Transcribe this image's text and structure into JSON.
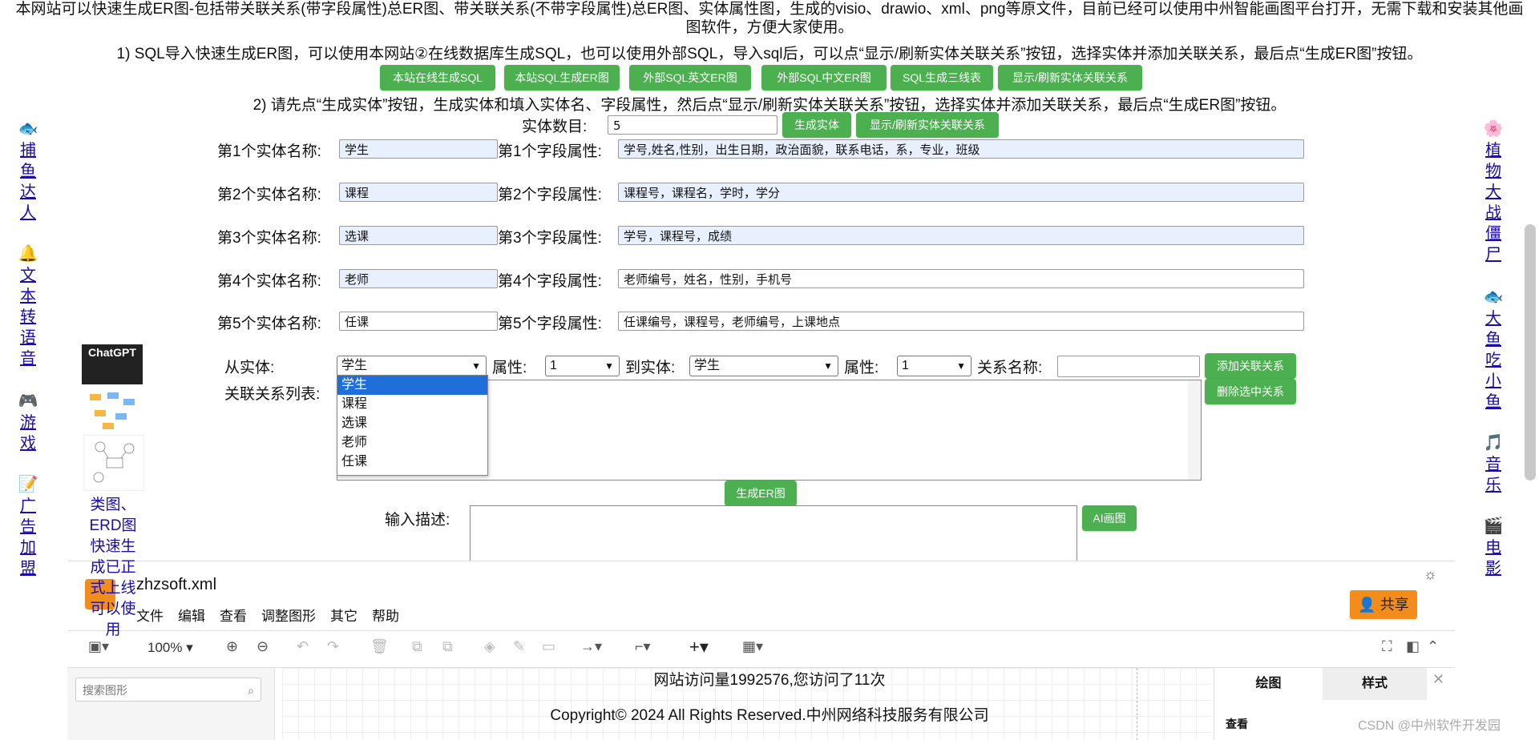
{
  "intro": {
    "text": "本网站可以快速生成ER图-包括带关联关系(带字段属性)总ER图、带关联关系(不带字段属性)总ER图、实体属性图，生成的visio、drawio、xml、png等原文件，目前已经可以使用中州智能画图平台打开，无需下载和安装其他画图软件，方便大家使用。",
    "step1": "1) SQL导入快速生成ER图，可以使用本网站②在线数据库生成SQL，也可以使用外部SQL，导入sql后，可以点“显示/刷新实体关联关系”按钮，选择实体并添加关联关系，最后点“生成ER图”按钮。",
    "step2": "2) 请先点“生成实体”按钮，生成实体和填入实体名、字段属性，然后点“显示/刷新实体关联关系”按钮，选择实体并添加关联关系，最后点“生成ER图”按钮。"
  },
  "top_buttons": [
    "本站在线生成SQL",
    "本站SQL生成ER图",
    "外部SQL英文ER图",
    "外部SQL中文ER图",
    "SQL生成三线表",
    "显示/刷新实体关联关系"
  ],
  "entity_count": {
    "label": "实体数目:",
    "value": "5",
    "gen_btn": "生成实体",
    "refresh_btn": "显示/刷新实体关联关系"
  },
  "entities": [
    {
      "name_label": "第1个实体名称:",
      "name": "学生",
      "field_label": "第1个字段属性:",
      "fields": "学号,姓名,性别，出生日期，政治面貌，联系电话，系，专业，班级"
    },
    {
      "name_label": "第2个实体名称:",
      "name": "课程",
      "field_label": "第2个字段属性:",
      "fields": "课程号，课程名，学时，学分"
    },
    {
      "name_label": "第3个实体名称:",
      "name": "选课",
      "field_label": "第3个字段属性:",
      "fields": "学号，课程号，成绩"
    },
    {
      "name_label": "第4个实体名称:",
      "name": "老师",
      "field_label": "第4个字段属性:",
      "fields": "老师编号，姓名，性别，手机号"
    },
    {
      "name_label": "第5个实体名称:",
      "name": "任课",
      "field_label": "第5个字段属性:",
      "fields": "任课编号，课程号，老师编号，上课地点"
    }
  ],
  "relation": {
    "from_label": "从实体:",
    "from_value": "学生",
    "attr_label": "属性:",
    "attr_value": "1",
    "to_label": "到实体:",
    "to_value": "学生",
    "attr2_label": "属性:",
    "attr2_value": "1",
    "name_label": "关系名称:",
    "add_btn": "添加关联关系",
    "del_btn": "删除选中关系",
    "list_label": "关联关系列表:",
    "dropdown_options": [
      "学生",
      "课程",
      "选课",
      "老师",
      "任课"
    ],
    "gen_er_btn": "生成ER图"
  },
  "ai": {
    "label": "输入描述:",
    "btn": "AI画图"
  },
  "left_links": [
    {
      "text": "捕鱼达人",
      "icon": "fish-icon"
    },
    {
      "text": "文本转语音",
      "icon": "bell-icon"
    },
    {
      "text": "游戏",
      "icon": "game-icon"
    },
    {
      "text": "广告加盟",
      "icon": "memo-icon"
    }
  ],
  "right_links": [
    {
      "text": "植物大战僵尸",
      "icon": "flower-icon"
    },
    {
      "text": "大鱼吃小鱼",
      "icon": "fish-icon"
    },
    {
      "text": "音乐",
      "icon": "music-icon"
    },
    {
      "text": "电影",
      "icon": "film-icon"
    }
  ],
  "promo": {
    "logo": "ChatGPT",
    "caption": "类图、ERD图快速生成已正式上线可以使用"
  },
  "editor": {
    "filename": "zhzsoft.xml",
    "menus": [
      "文件",
      "编辑",
      "查看",
      "调整图形",
      "其它",
      "帮助"
    ],
    "share_btn": "共享",
    "zoom": "100%",
    "search_placeholder": "搜索图形",
    "panel_tabs": [
      "绘图",
      "样式"
    ],
    "panel_section": "查看",
    "visits": "网站访问量1992576,您访问了11次",
    "copyright": "Copyright© 2024 All Rights Reserved.中州网络科技服务有限公司"
  },
  "watermark": "CSDN @中州软件开发园"
}
